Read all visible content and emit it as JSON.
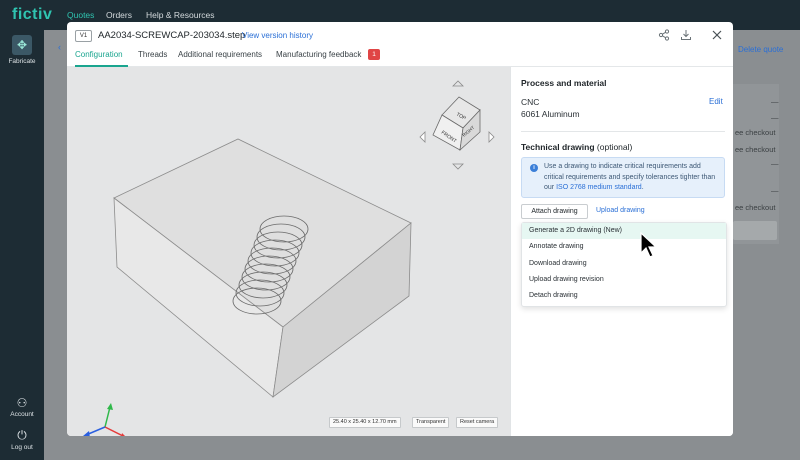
{
  "app": {
    "logo": "fictiv"
  },
  "topnav": {
    "items": [
      "Quotes",
      "Orders",
      "Help & Resources"
    ]
  },
  "rail": {
    "fabricate_label": "Fabricate",
    "account_label": "Account",
    "logout_label": "Log out"
  },
  "background": {
    "delete_quote": "Delete quote",
    "dash": "—",
    "see_checkout": "ee checkout"
  },
  "modal": {
    "version": "V1",
    "filename": "AA2034-SCREWCAP-203034.step",
    "version_history": "View version history",
    "tabs": [
      "Configuration",
      "Threads",
      "Additional requirements",
      "Manufacturing feedback"
    ],
    "feedback_count": "1",
    "icons": [
      "share-icon",
      "download-icon",
      "close-icon"
    ]
  },
  "viewer": {
    "cube_faces": {
      "top": "TOP",
      "front": "FRONT",
      "right": "RIGHT"
    },
    "dimensions": "25.40 x 25.40 x 12.70 mm",
    "transparent_label": "Transparent",
    "reset_label": "Reset camera",
    "colors": {
      "x_axis": "#e53b3b",
      "y_axis": "#2fb84a",
      "z_axis": "#2a5fe0"
    }
  },
  "panel": {
    "process_title": "Process and material",
    "process": "CNC",
    "material": "6061 Aluminum",
    "edit_label": "Edit",
    "technical_drawing_title": "Technical drawing",
    "technical_drawing_optional": "(optional)",
    "info_text": "Use a drawing to indicate critical requirements add critical requirements and specify tolerances tighter than our",
    "info_link": "ISO 2768 medium standard",
    "info_end": ".",
    "attach_label": "Attach drawing",
    "upload_label": "Upload drawing",
    "menu": [
      "Generate a 2D drawing (New)",
      "Annotate drawing",
      "Download drawing",
      "Upload drawing revision",
      "Detach drawing"
    ]
  }
}
